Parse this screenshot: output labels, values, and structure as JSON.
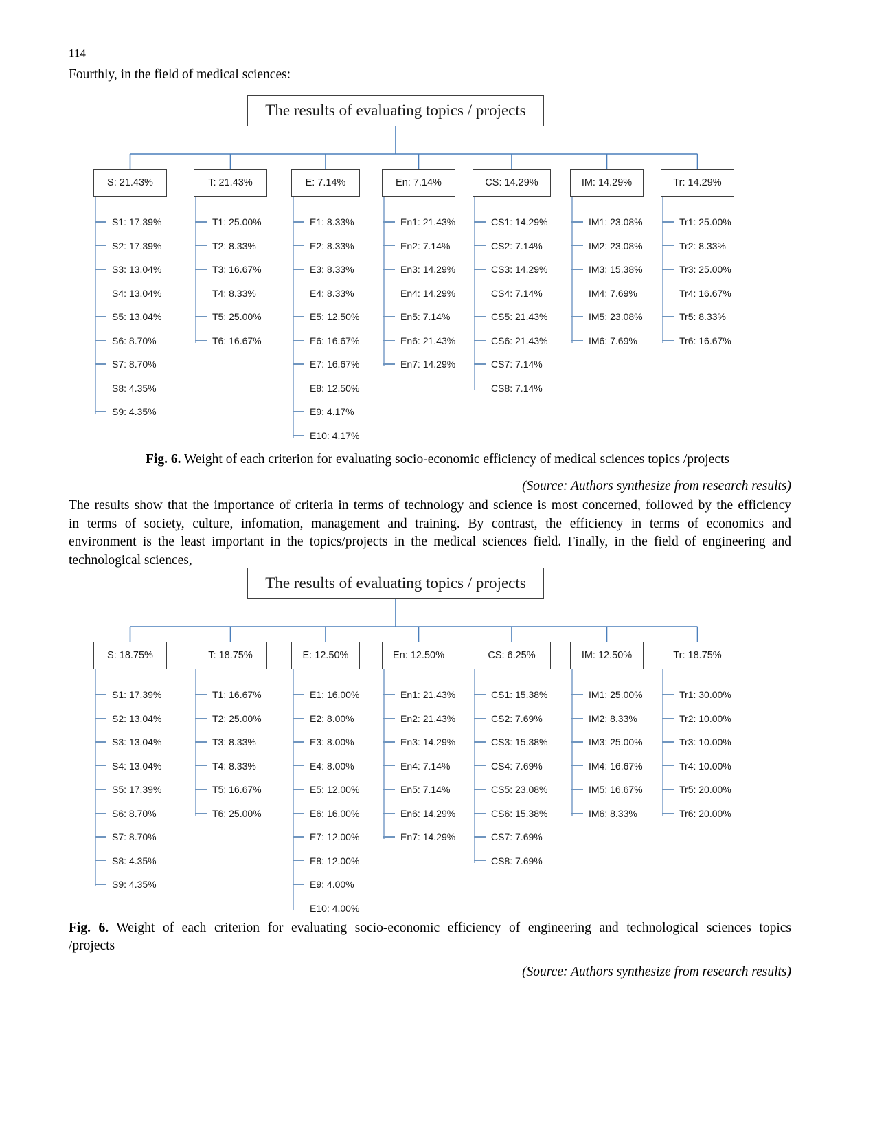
{
  "page": {
    "number": "114",
    "intro_line": "Fourthly, in the field of medical sciences:"
  },
  "figure1": {
    "root_label": "The results of evaluating topics / projects",
    "caption_prefix": "Fig. 6.",
    "caption_text": " Weight of each criterion for evaluating socio-economic efficiency of medical sciences topics /projects",
    "source_note": "(Source: Authors synthesize from research results)",
    "columns": [
      {
        "head": "S: 21.43%",
        "items": [
          "S1: 17.39%",
          "S2: 17.39%",
          "S3: 13.04%",
          "S4: 13.04%",
          "S5: 13.04%",
          "S6: 8.70%",
          "S7: 8.70%",
          "S8: 4.35%",
          "S9: 4.35%"
        ]
      },
      {
        "head": "T: 21.43%",
        "items": [
          "T1: 25.00%",
          "T2: 8.33%",
          "T3: 16.67%",
          "T4: 8.33%",
          "T5: 25.00%",
          "T6: 16.67%"
        ]
      },
      {
        "head": "E: 7.14%",
        "items": [
          "E1: 8.33%",
          "E2: 8.33%",
          "E3: 8.33%",
          "E4: 8.33%",
          "E5: 12.50%",
          "E6: 16.67%",
          "E7: 16.67%",
          "E8: 12.50%",
          "E9: 4.17%",
          "E10: 4.17%"
        ]
      },
      {
        "head": "En: 7.14%",
        "items": [
          "En1: 21.43%",
          "En2: 7.14%",
          "En3: 14.29%",
          "En4: 14.29%",
          "En5: 7.14%",
          "En6: 21.43%",
          "En7: 14.29%"
        ]
      },
      {
        "head": "CS: 14.29%",
        "items": [
          "CS1: 14.29%",
          "CS2: 7.14%",
          "CS3: 14.29%",
          "CS4: 7.14%",
          "CS5: 21.43%",
          "CS6: 21.43%",
          "CS7: 7.14%",
          "CS8: 7.14%"
        ]
      },
      {
        "head": "IM: 14.29%",
        "items": [
          "IM1: 23.08%",
          "IM2: 23.08%",
          "IM3: 15.38%",
          "IM4: 7.69%",
          "IM5: 23.08%",
          "IM6: 7.69%"
        ]
      },
      {
        "head": "Tr: 14.29%",
        "items": [
          "Tr1: 25.00%",
          "Tr2: 8.33%",
          "Tr3: 25.00%",
          "Tr4: 16.67%",
          "Tr5: 8.33%",
          "Tr6: 16.67%"
        ]
      }
    ]
  },
  "paragraph": {
    "line1": "The results show that the importance of criteria in terms of technology and science is most concerned, followed by the efficiency",
    "line2": "in terms of society, culture, infomation, management and training. By contrast, the efficiency in terms of economics and",
    "line3": "environment is the least important  in the topics/projects in the medical sciences field. Finally, in the field of engineering and",
    "line4": "technological sciences,"
  },
  "figure2": {
    "root_label": "The results of evaluating topics / projects",
    "caption_prefix": "Fig. 6.",
    "caption_line1": " Weight of each criterion for evaluating socio-economic efficiency of engineering and technological sciences topics",
    "caption_line2": "/projects",
    "source_note": "(Source: Authors synthesize from research results)",
    "columns": [
      {
        "head": "S: 18.75%",
        "items": [
          "S1: 17.39%",
          "S2: 13.04%",
          "S3: 13.04%",
          "S4: 13.04%",
          "S5: 17.39%",
          "S6: 8.70%",
          "S7: 8.70%",
          "S8: 4.35%",
          "S9: 4.35%"
        ]
      },
      {
        "head": "T: 18.75%",
        "items": [
          "T1: 16.67%",
          "T2: 25.00%",
          "T3: 8.33%",
          "T4: 8.33%",
          "T5: 16.67%",
          "T6: 25.00%"
        ]
      },
      {
        "head": "E: 12.50%",
        "items": [
          "E1: 16.00%",
          "E2: 8.00%",
          "E3: 8.00%",
          "E4: 8.00%",
          "E5: 12.00%",
          "E6: 16.00%",
          "E7: 12.00%",
          "E8: 12.00%",
          "E9: 4.00%",
          "E10: 4.00%"
        ]
      },
      {
        "head": "En: 12.50%",
        "items": [
          "En1: 21.43%",
          "En2: 21.43%",
          "En3: 14.29%",
          "En4: 7.14%",
          "En5: 7.14%",
          "En6: 14.29%",
          "En7: 14.29%"
        ]
      },
      {
        "head": "CS: 6.25%",
        "items": [
          "CS1: 15.38%",
          "CS2: 7.69%",
          "CS3: 15.38%",
          "CS4: 7.69%",
          "CS5: 23.08%",
          "CS6: 15.38%",
          "CS7: 7.69%",
          "CS8: 7.69%"
        ]
      },
      {
        "head": "IM: 12.50%",
        "items": [
          "IM1: 25.00%",
          "IM2: 8.33%",
          "IM3: 25.00%",
          "IM4: 16.67%",
          "IM5: 16.67%",
          "IM6: 8.33%"
        ]
      },
      {
        "head": "Tr: 18.75%",
        "items": [
          "Tr1: 30.00%",
          "Tr2: 10.00%",
          "Tr3: 10.00%",
          "Tr4: 10.00%",
          "Tr5: 20.00%",
          "Tr6: 20.00%"
        ]
      }
    ]
  },
  "style": {
    "connector_color": "#4a7ebb",
    "spine_color": "#9cb6d6",
    "box_border": "#3f3f3f"
  }
}
